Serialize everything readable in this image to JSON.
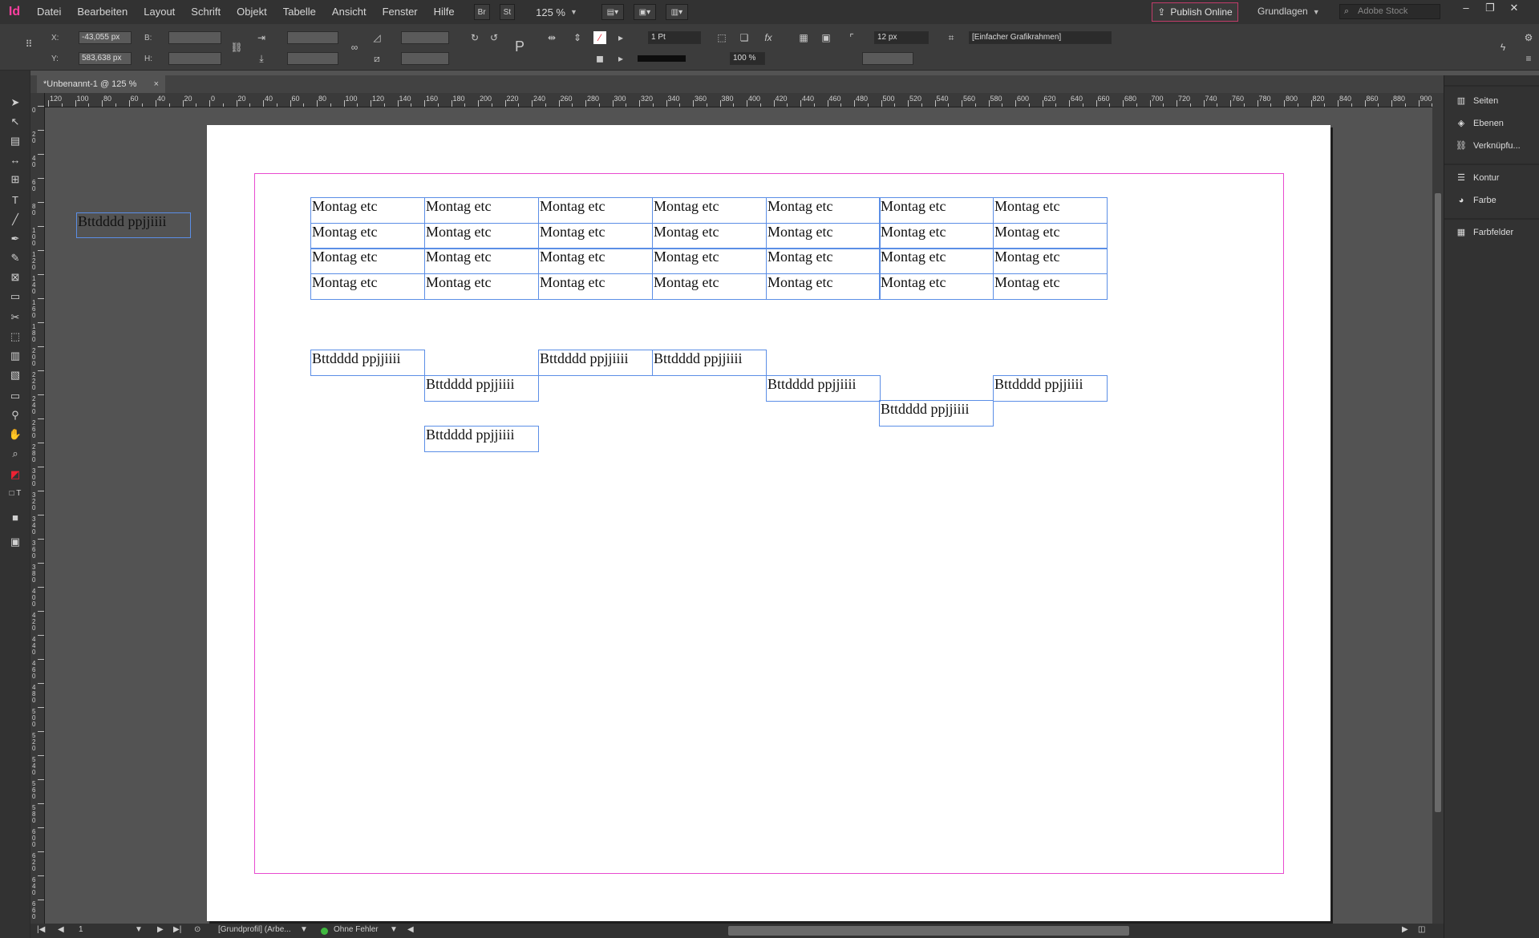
{
  "app": {
    "logo": "Id"
  },
  "menu": [
    "Datei",
    "Bearbeiten",
    "Layout",
    "Schrift",
    "Objekt",
    "Tabelle",
    "Ansicht",
    "Fenster",
    "Hilfe"
  ],
  "menubar": {
    "bridge": "Br",
    "stock": "St",
    "zoom": "125 %",
    "publish": "Publish Online",
    "workspace": "Grundlagen",
    "search_placeholder": "Adobe Stock"
  },
  "control": {
    "x_label": "X:",
    "y_label": "Y:",
    "x_value": "-43,055 px",
    "y_value": "583,638 px",
    "w_label": "B:",
    "h_label": "H:",
    "stroke_weight": "1 Pt",
    "opacity": "100 %",
    "size": "12 px",
    "object_style": "[Einfacher Grafikrahmen]"
  },
  "tab": {
    "title": "*Unbenannt-1 @ 125 %",
    "close": "×"
  },
  "ruler_h": [
    "120",
    "100",
    "80",
    "60",
    "40",
    "20",
    "0",
    "20",
    "40",
    "60",
    "80",
    "100",
    "120",
    "140",
    "160",
    "180",
    "200",
    "220",
    "240",
    "260",
    "280",
    "300",
    "320",
    "340",
    "360",
    "380",
    "400",
    "420",
    "440",
    "460",
    "480",
    "500",
    "520",
    "540",
    "560",
    "580",
    "600",
    "620",
    "640",
    "660",
    "680",
    "700",
    "720",
    "740",
    "760",
    "780",
    "800",
    "820",
    "840",
    "860",
    "880",
    "900"
  ],
  "ruler_v": [
    "0",
    "20",
    "40",
    "60",
    "80",
    "100",
    "120",
    "140",
    "160",
    "180",
    "200",
    "220",
    "240",
    "260",
    "280",
    "300",
    "320",
    "340",
    "360",
    "380",
    "400",
    "420",
    "440",
    "460",
    "480",
    "500",
    "520",
    "540",
    "560",
    "580",
    "600",
    "620",
    "640",
    "660",
    "680"
  ],
  "canvas": {
    "pasteboard_text": "Bttdddd ppjjiiii",
    "table_text": "Montag etc",
    "frame_text": "Bttdddd ppjjiiii"
  },
  "status": {
    "page": "1",
    "profile": "[Grundprofil] (Arbe...",
    "errors": "Ohne Fehler"
  },
  "panels": [
    "Seiten",
    "Ebenen",
    "Verknüpfu...",
    "Kontur",
    "Farbe",
    "Farbfelder"
  ]
}
